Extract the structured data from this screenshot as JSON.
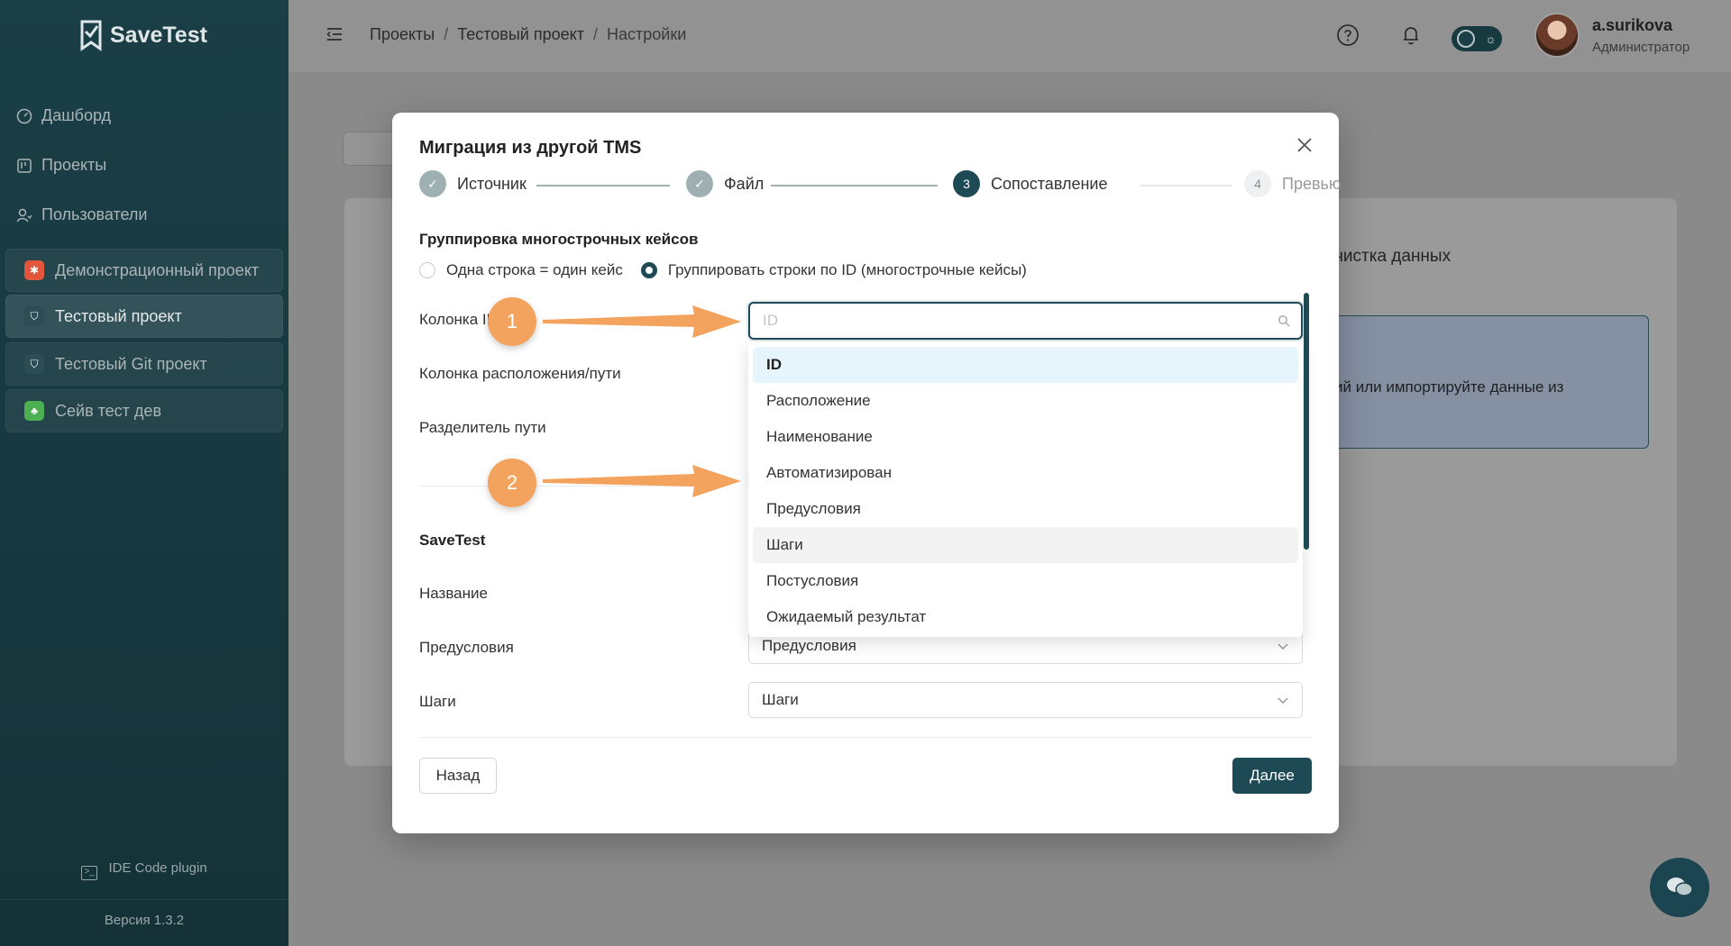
{
  "sidebar": {
    "logo_text": "SaveTest",
    "nav": [
      {
        "label": "Дашборд",
        "icon": "dashboard-icon"
      },
      {
        "label": "Проекты",
        "icon": "projects-icon"
      },
      {
        "label": "Пользователи",
        "icon": "users-icon"
      }
    ],
    "projects": [
      {
        "label": "Демонстрационный проект",
        "badge_color": "#e2573b",
        "icon": "bug-icon"
      },
      {
        "label": "Тестовый проект",
        "badge_color": "#2c4d55",
        "icon": "bookmark-icon"
      },
      {
        "label": "Тестовый Git проект",
        "badge_color": "#2c4d55",
        "icon": "bookmark-icon"
      },
      {
        "label": "Сейв тест дев",
        "badge_color": "#4caf50",
        "icon": "leaf-icon"
      }
    ],
    "plugin_label": "IDE Code plugin",
    "version_label": "Версия 1.3.2"
  },
  "header": {
    "breadcrumb": [
      "Проекты",
      "Тестовый проект",
      "Настройки"
    ],
    "breadcrumb_sep": "/",
    "user_name": "a.surikova",
    "user_role": "Администратор"
  },
  "background": {
    "tab_text": "чистка данных",
    "info_text": "ий или импортируйте данные из"
  },
  "modal": {
    "title": "Миграция из другой TMS",
    "steps": [
      {
        "label": "Источник",
        "state": "done",
        "marker": "✓"
      },
      {
        "label": "Файл",
        "state": "done",
        "marker": "✓"
      },
      {
        "label": "Сопоставление",
        "state": "current",
        "marker": "3"
      },
      {
        "label": "Превью",
        "state": "todo",
        "marker": "4"
      }
    ],
    "grouping_title": "Группировка многострочных кейсов",
    "radio_options": [
      {
        "label": "Одна строка = один кейс",
        "checked": false
      },
      {
        "label": "Группировать строки по ID (многострочные кейсы)",
        "checked": true
      }
    ],
    "fields": {
      "id_column_label": "Колонка ID",
      "path_column_label": "Колонка расположения/пути",
      "path_separator_label": "Разделитель пути",
      "savetest_heading": "SaveTest",
      "name_label": "Название",
      "preconditions_label": "Предусловия",
      "preconditions_value": "Предусловия",
      "steps_label": "Шаги",
      "steps_value": "Шаги"
    },
    "search": {
      "placeholder": "ID",
      "value": ""
    },
    "dropdown_options": [
      {
        "label": "ID",
        "state": "selected"
      },
      {
        "label": "Расположение",
        "state": ""
      },
      {
        "label": "Наименование",
        "state": ""
      },
      {
        "label": "Автоматизирован",
        "state": ""
      },
      {
        "label": "Предусловия",
        "state": ""
      },
      {
        "label": "Шаги",
        "state": "hover"
      },
      {
        "label": "Постусловия",
        "state": ""
      },
      {
        "label": "Ожидаемый результат",
        "state": ""
      }
    ],
    "back_button": "Назад",
    "next_button": "Далее"
  },
  "annotations": [
    {
      "label": "1"
    },
    {
      "label": "2"
    }
  ],
  "colors": {
    "accent": "#1d4a55",
    "sidebar_bg": "#1b3f47",
    "callout": "#f3a35d",
    "dropdown_selected": "#e6f4fb"
  }
}
